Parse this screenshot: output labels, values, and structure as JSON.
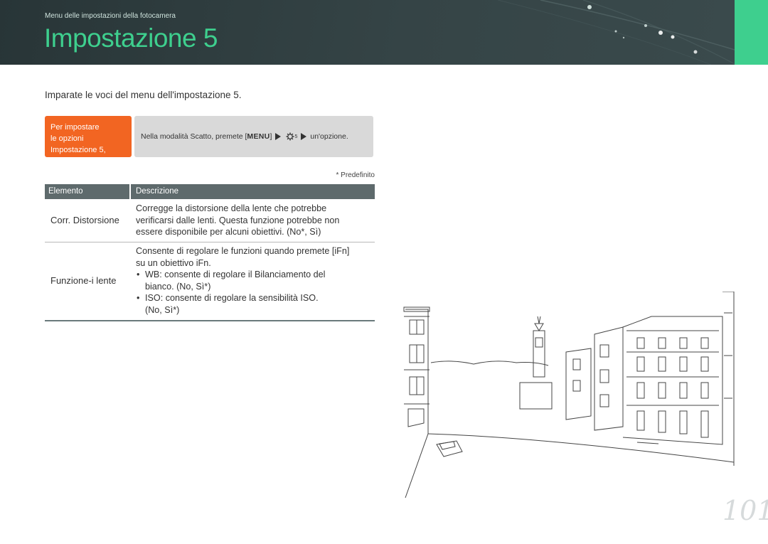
{
  "header": {
    "breadcrumb": "Menu delle impostazioni della fotocamera",
    "title": "Impostazione 5"
  },
  "intro": "Imparate le voci del menu dell'impostazione 5.",
  "howto": {
    "label_lines": [
      "Per impostare",
      "le opzioni",
      "Impostazione 5,"
    ],
    "text_before": "Nella modalità Scatto, premete [",
    "menu_key": "MENU",
    "text_bracket": "]",
    "text_sub": "5",
    "text_after": "un'opzione."
  },
  "default_note": "* Predefinito",
  "table": {
    "headers": [
      "Elemento",
      "Descrizione"
    ],
    "rows": [
      {
        "item": "Corr. Distorsione",
        "desc_lines": [
          "Corregge la distorsione della lente che potrebbe",
          "verificarsi dalle lenti. Questa funzione potrebbe non",
          "essere disponibile per alcuni obiettivi. (No*, Sì)"
        ]
      },
      {
        "item": "Funzione-i lente",
        "desc_lines": [
          "Consente di regolare le funzioni quando premete [iFn]",
          "su un obiettivo iFn."
        ],
        "bullets": [
          [
            "WB: consente di regolare il Bilanciamento del",
            "bianco. (No, Sì*)"
          ],
          [
            "ISO: consente di regolare la sensibilità ISO.",
            "(No, Sì*)"
          ]
        ]
      }
    ]
  },
  "page_number": "101",
  "colors": {
    "accent_green": "#3ecf8e",
    "header_dark": "#2f3d3f",
    "orange": "#f26522",
    "table_header": "#5e6a6c"
  },
  "icons": [
    "settings-gear-icon",
    "arrow-right-icon"
  ]
}
